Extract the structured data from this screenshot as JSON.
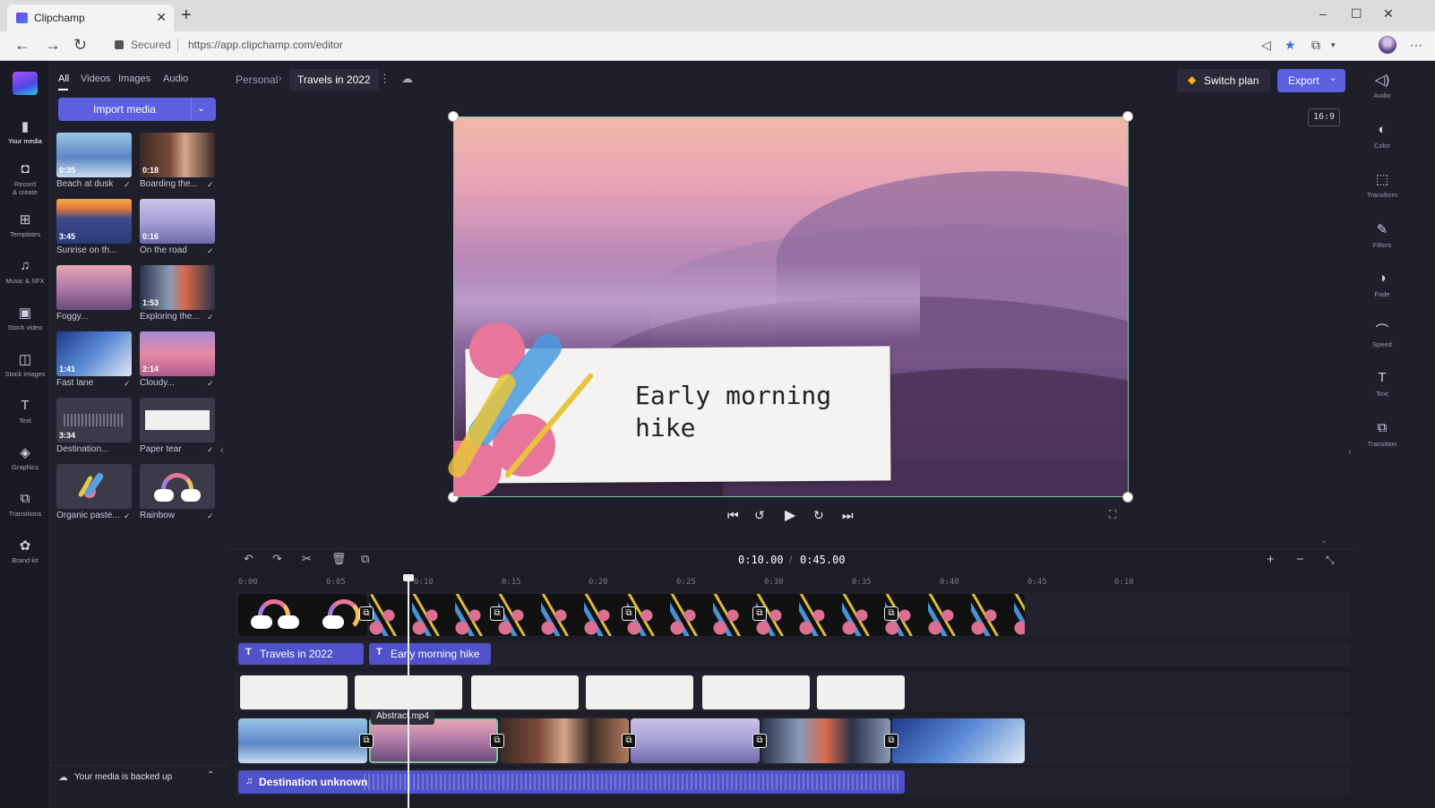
{
  "browser": {
    "tab_title": "Clipchamp",
    "new_tab": "+",
    "security_label": "Secured",
    "url": "https://app.clipchamp.com/editor",
    "window_controls": [
      "–",
      "☐",
      "✕"
    ]
  },
  "left_rail": {
    "items": [
      {
        "icon": "folder-icon",
        "glyph": "▮",
        "label_1": "Your media",
        "label_2": ""
      },
      {
        "icon": "camera-icon",
        "glyph": "◘",
        "label_1": "Record",
        "label_2": "& create"
      },
      {
        "icon": "templates-icon",
        "glyph": "⊞",
        "label_1": "Templates",
        "label_2": ""
      },
      {
        "icon": "music-icon",
        "glyph": "♫",
        "label_1": "Music & SFX",
        "label_2": ""
      },
      {
        "icon": "film-icon",
        "glyph": "▣",
        "label_1": "Stock video",
        "label_2": ""
      },
      {
        "icon": "image-icon",
        "glyph": "◫",
        "label_1": "Stock images",
        "label_2": ""
      },
      {
        "icon": "text-icon",
        "glyph": "T",
        "label_1": "Text",
        "label_2": ""
      },
      {
        "icon": "shapes-icon",
        "glyph": "◈",
        "label_1": "Graphics",
        "label_2": ""
      },
      {
        "icon": "transition-icon",
        "glyph": "⧉",
        "label_1": "Transitions",
        "label_2": ""
      },
      {
        "icon": "brand-kit-icon",
        "glyph": "✿",
        "label_1": "Brand kit",
        "label_2": ""
      }
    ]
  },
  "media_panel": {
    "tabs": [
      "All",
      "Videos",
      "Images",
      "Audio"
    ],
    "import_label": "Import media",
    "items": [
      {
        "label": "Beach at dusk",
        "duration": "0:35"
      },
      {
        "label": "Boarding the...",
        "duration": "0:18"
      },
      {
        "label": "Sunrise on th...",
        "duration": "3:45"
      },
      {
        "label": "On the road",
        "duration": "0:16"
      },
      {
        "label": "Foggy...",
        "duration": ""
      },
      {
        "label": "Exploring the...",
        "duration": "1:53"
      },
      {
        "label": "Fast lane",
        "duration": "1:41"
      },
      {
        "label": "Cloudy...",
        "duration": "2:14"
      },
      {
        "label": "Destination...",
        "duration": "3:34"
      },
      {
        "label": "Paper tear",
        "duration": ""
      },
      {
        "label": "Organic paste...",
        "duration": ""
      },
      {
        "label": "Rainbow",
        "duration": ""
      }
    ],
    "backup_text": "Your media is backed up"
  },
  "topbar": {
    "breadcrumb_parent": "Personal",
    "breadcrumb_sep": "›",
    "project_title": "Travels in 2022",
    "switch_plan_label": "Switch plan",
    "export_label": "Export",
    "aspect_ratio": "16:9"
  },
  "preview": {
    "caption_line1": "Early morning",
    "caption_line2": "hike"
  },
  "right_panel": {
    "items": [
      {
        "icon": "audio-icon",
        "glyph": "🔈",
        "label": "Audio"
      },
      {
        "icon": "color-icon",
        "glyph": "◐",
        "label": "Color"
      },
      {
        "icon": "transform-icon",
        "glyph": "⬚",
        "label": "Transform"
      },
      {
        "icon": "filters-icon",
        "glyph": "✎",
        "label": "Filters"
      },
      {
        "icon": "fade-icon",
        "glyph": "◑",
        "label": "Fade"
      },
      {
        "icon": "speed-icon",
        "glyph": "⌒",
        "label": "Speed"
      },
      {
        "icon": "text-icon",
        "glyph": "T",
        "label": "Text"
      },
      {
        "icon": "transition-icon",
        "glyph": "⧉",
        "label": "Transition"
      }
    ]
  },
  "timeline": {
    "current_time": "0:10.00",
    "separator": "/",
    "total_time": "0:45.00",
    "ticks": [
      "0:00",
      "0:05",
      "0:10",
      "0:15",
      "0:20",
      "0:25",
      "0:30",
      "0:35",
      "0:40",
      "0:45",
      "0:10"
    ],
    "text_clips": [
      "Travels in 2022",
      "Early morning hike"
    ],
    "hover_tooltip": "Abstract.mp4",
    "audio_clip": "Destination unknown"
  },
  "colors": {
    "accent": "#5b5fe0",
    "background": "#1f1f2b",
    "text_clip": "#4f52c9"
  }
}
